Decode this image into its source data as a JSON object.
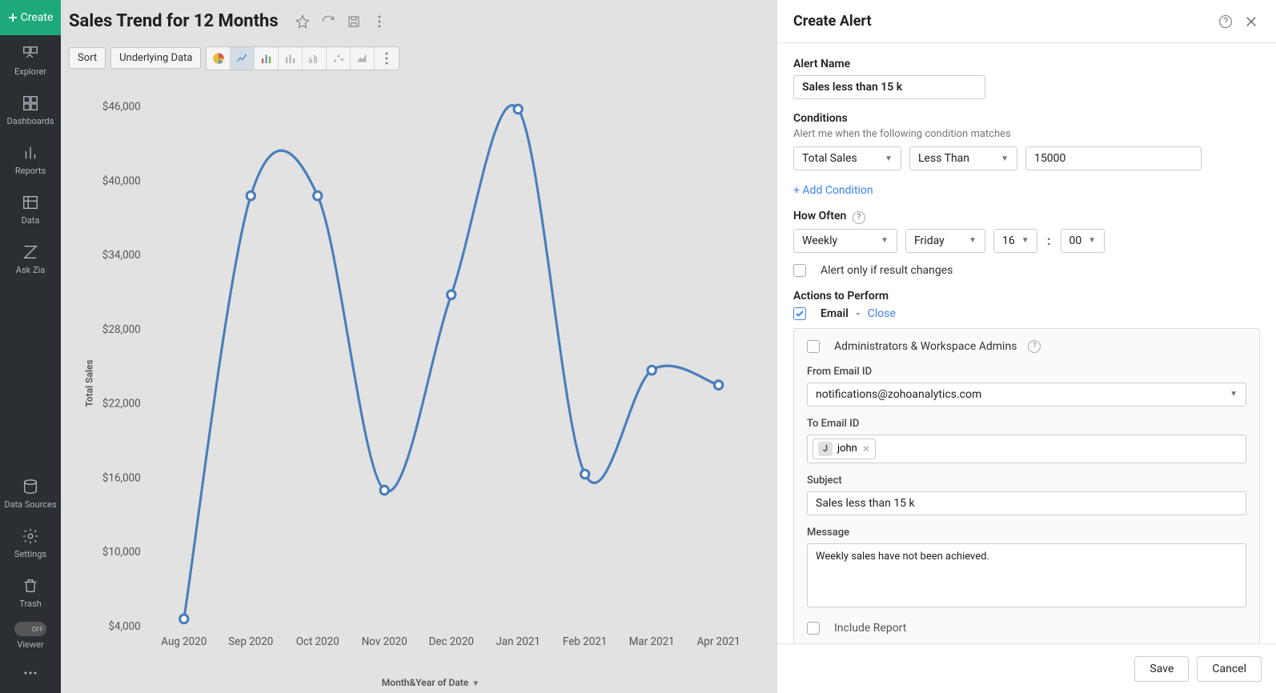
{
  "sidebar": {
    "create": "Create",
    "items": [
      {
        "label": "Explorer",
        "icon": "explorer-icon"
      },
      {
        "label": "Dashboards",
        "icon": "dashboards-icon"
      },
      {
        "label": "Reports",
        "icon": "reports-icon"
      },
      {
        "label": "Data",
        "icon": "data-icon"
      },
      {
        "label": "Ask Zia",
        "icon": "askzia-icon"
      }
    ],
    "bottom": [
      {
        "label": "Data Sources",
        "icon": "datasources-icon"
      },
      {
        "label": "Settings",
        "icon": "settings-icon"
      },
      {
        "label": "Trash",
        "icon": "trash-icon"
      }
    ],
    "viewer_pill": "OFF",
    "viewer": "Viewer"
  },
  "report": {
    "title": "Sales Trend for 12 Months",
    "sort_btn": "Sort",
    "underlying_btn": "Underlying Data",
    "ylabel": "Total Sales",
    "xlabel": "Month&Year of Date"
  },
  "chart_data": {
    "type": "line",
    "xlabel": "Month&Year of Date",
    "ylabel": "Total Sales",
    "ylim": [
      4000,
      46000
    ],
    "yticks": [
      4000,
      10000,
      16000,
      22000,
      28000,
      34000,
      40000,
      46000
    ],
    "ytick_labels": [
      "$4,000",
      "$10,000",
      "$16,000",
      "$22,000",
      "$28,000",
      "$34,000",
      "$40,000",
      "$46,000"
    ],
    "categories": [
      "Aug 2020",
      "Sep 2020",
      "Oct 2020",
      "Nov 2020",
      "Dec 2020",
      "Jan 2021",
      "Feb 2021",
      "Mar 2021",
      "Apr 2021"
    ],
    "values": [
      4600,
      38800,
      38800,
      15000,
      30800,
      45800,
      16300,
      24700,
      23500
    ]
  },
  "panel": {
    "title": "Create Alert",
    "alert_name_label": "Alert Name",
    "alert_name_value": "Sales less than 15 k",
    "conditions_label": "Conditions",
    "conditions_sub": "Alert me when the following condition matches",
    "cond_field": "Total Sales",
    "cond_op": "Less Than",
    "cond_value": "15000",
    "add_condition": "+ Add Condition",
    "how_often_label": "How Often",
    "freq": "Weekly",
    "day": "Friday",
    "hour": "16",
    "minute": "00",
    "only_if_changes": "Alert only if result changes",
    "actions_label": "Actions to Perform",
    "email_label": "Email",
    "email_dash": " - ",
    "email_close": "Close",
    "admins_label": "Administrators & Workspace Admins",
    "from_label": "From Email ID",
    "from_value": "notifications@zohoanalytics.com",
    "to_label": "To Email ID",
    "to_chip_initial": "J",
    "to_chip_name": "john",
    "subject_label": "Subject",
    "subject_value": "Sales less than 15 k",
    "message_label": "Message",
    "message_value": "Weekly sales have not been achieved.",
    "include_report": "Include Report",
    "save": "Save",
    "cancel": "Cancel"
  }
}
